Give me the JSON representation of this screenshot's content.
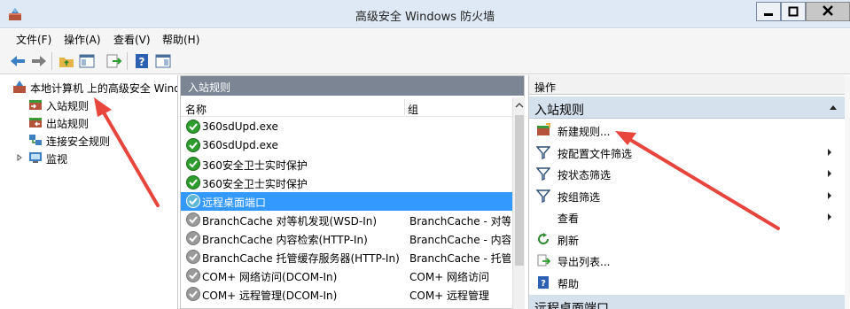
{
  "window": {
    "title": "高级安全 Windows 防火墙"
  },
  "menu": {
    "items": [
      "文件(F)",
      "操作(A)",
      "查看(V)",
      "帮助(H)"
    ]
  },
  "tree": {
    "root_label": "本地计算机 上的高级安全 Wind",
    "items": [
      {
        "label": "入站规则",
        "selected": true
      },
      {
        "label": "出站规则"
      },
      {
        "label": "连接安全规则"
      },
      {
        "label": "监视",
        "expandable": true
      }
    ]
  },
  "rules_pane": {
    "title": "入站规则",
    "col_name": "名称",
    "col_group": "组",
    "rows": [
      {
        "name": "360sdUpd.exe",
        "group": "",
        "status": "enabled"
      },
      {
        "name": "360sdUpd.exe",
        "group": "",
        "status": "enabled"
      },
      {
        "name": "360安全卫士实时保护",
        "group": "",
        "status": "enabled"
      },
      {
        "name": "360安全卫士实时保护",
        "group": "",
        "status": "enabled"
      },
      {
        "name": "远程桌面端口",
        "group": "",
        "status": "selected"
      },
      {
        "name": "BranchCache 对等机发现(WSD-In)",
        "group": "BranchCache - 对等机",
        "status": "disabled"
      },
      {
        "name": "BranchCache 内容检索(HTTP-In)",
        "group": "BranchCache - 内容检",
        "status": "disabled"
      },
      {
        "name": "BranchCache 托管缓存服务器(HTTP-In)",
        "group": "BranchCache - 托管缓",
        "status": "disabled"
      },
      {
        "name": "COM+ 网络访问(DCOM-In)",
        "group": "COM+ 网络访问",
        "status": "disabled"
      },
      {
        "name": "COM+ 远程管理(DCOM-In)",
        "group": "COM+ 远程管理",
        "status": "disabled"
      }
    ]
  },
  "actions": {
    "title": "操作",
    "section_title": "入站规则",
    "items": [
      {
        "label": "新建规则...",
        "icon": "new-rule-icon",
        "submenu": false
      },
      {
        "label": "按配置文件筛选",
        "icon": "filter-icon",
        "submenu": true
      },
      {
        "label": "按状态筛选",
        "icon": "filter-icon",
        "submenu": true
      },
      {
        "label": "按组筛选",
        "icon": "filter-icon",
        "submenu": true
      },
      {
        "label": "查看",
        "icon": "",
        "submenu": true
      },
      {
        "label": "刷新",
        "icon": "refresh-icon",
        "submenu": false
      },
      {
        "label": "导出列表...",
        "icon": "export-icon",
        "submenu": false
      },
      {
        "label": "帮助",
        "icon": "help-icon",
        "submenu": false
      }
    ],
    "section2_title": "远程桌面端口"
  },
  "colors": {
    "pane_header": "#7b8594",
    "selection": "#3399ff",
    "action_section": "#d6e1ee",
    "annotation": "#e8453c"
  }
}
